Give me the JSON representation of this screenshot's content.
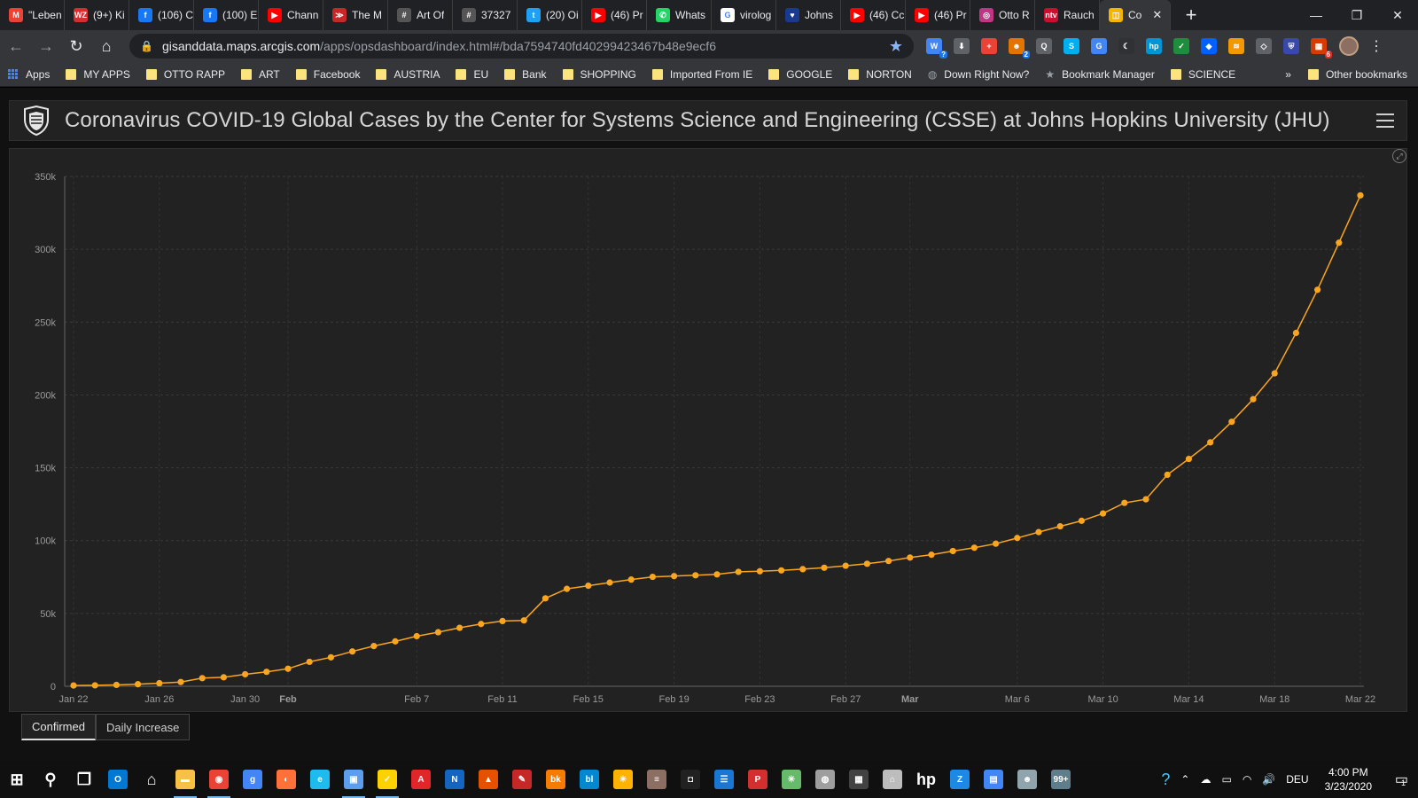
{
  "browser": {
    "tabs": [
      {
        "label": "\"Leben",
        "icon": "gmail-icon",
        "color": "#ea4335",
        "glyph": "M"
      },
      {
        "label": "(9+) Ki",
        "icon": "wz-icon",
        "color": "#d32f2f",
        "glyph": "WZ"
      },
      {
        "label": "(106) C",
        "icon": "facebook-icon",
        "color": "#1877f2",
        "glyph": "f"
      },
      {
        "label": "(100) E",
        "icon": "facebook-icon",
        "color": "#1877f2",
        "glyph": "f"
      },
      {
        "label": "Chann",
        "icon": "youtube-icon",
        "color": "#ff0000",
        "glyph": "▶"
      },
      {
        "label": "The M",
        "icon": "red-swirl-icon",
        "color": "#c62828",
        "glyph": "≫"
      },
      {
        "label": "Art Of",
        "icon": "art-icon",
        "color": "#555555",
        "glyph": "#"
      },
      {
        "label": "37327",
        "icon": "art-icon",
        "color": "#555555",
        "glyph": "#"
      },
      {
        "label": "(20) Oi",
        "icon": "twitter-icon",
        "color": "#1da1f2",
        "glyph": "t"
      },
      {
        "label": "(46) Pr",
        "icon": "youtube-icon",
        "color": "#ff0000",
        "glyph": "▶"
      },
      {
        "label": "Whats",
        "icon": "whatsapp-icon",
        "color": "#25d366",
        "glyph": "✆"
      },
      {
        "label": "virolog",
        "icon": "google-icon",
        "color": "#ffffff",
        "glyph": "G"
      },
      {
        "label": "Johns",
        "icon": "jhu-icon",
        "color": "#1a3a8f",
        "glyph": "♥"
      },
      {
        "label": "(46) Cc",
        "icon": "youtube-icon",
        "color": "#ff0000",
        "glyph": "▶"
      },
      {
        "label": "(46) Pr",
        "icon": "youtube-icon",
        "color": "#ff0000",
        "glyph": "▶"
      },
      {
        "label": "Otto R",
        "icon": "instagram-icon",
        "color": "#c13584",
        "glyph": "◎"
      },
      {
        "label": "Rauch",
        "icon": "ntv-icon",
        "color": "#c8102e",
        "glyph": "ntv"
      },
      {
        "label": "Co",
        "icon": "arcgis-icon",
        "color": "#f5b400",
        "glyph": "◫",
        "active": true
      }
    ],
    "new_tab": "+",
    "window_controls": {
      "minimize": "—",
      "restore": "❐",
      "close": "✕"
    },
    "url_host": "gisanddata.maps.arcgis.com",
    "url_path": "/apps/opsdashboard/index.html#/bda7594740fd40299423467b48e9ecf6",
    "extensions": [
      {
        "name": "translate-ext-icon",
        "color": "#4285f4",
        "glyph": "W",
        "badge": "?"
      },
      {
        "name": "download-ext-icon",
        "color": "#5f6368",
        "glyph": "⬇",
        "badge": ""
      },
      {
        "name": "plus-ext-icon",
        "color": "#ea4335",
        "glyph": "+",
        "badge": ""
      },
      {
        "name": "people-ext-icon",
        "color": "#e37400",
        "glyph": "☻",
        "badge": "2"
      },
      {
        "name": "search-ext-icon",
        "color": "#5f6368",
        "glyph": "Q",
        "badge": ""
      },
      {
        "name": "skype-ext-icon",
        "color": "#00aff0",
        "glyph": "S",
        "badge": ""
      },
      {
        "name": "gtranslate-ext-icon",
        "color": "#4285f4",
        "glyph": "G",
        "badge": ""
      },
      {
        "name": "moon-ext-icon",
        "color": "#303134",
        "glyph": "☾",
        "badge": ""
      },
      {
        "name": "hp-ext-icon",
        "color": "#0096d6",
        "glyph": "hp",
        "badge": ""
      },
      {
        "name": "check-ext-icon",
        "color": "#1e8e3e",
        "glyph": "✓",
        "badge": ""
      },
      {
        "name": "dropbox-ext-icon",
        "color": "#0061ff",
        "glyph": "◆",
        "badge": ""
      },
      {
        "name": "rss-ext-icon",
        "color": "#f29900",
        "glyph": "≋",
        "badge": ""
      },
      {
        "name": "diamond-ext-icon",
        "color": "#5f6368",
        "glyph": "◇",
        "badge": ""
      },
      {
        "name": "shield-ext-icon",
        "color": "#3949ab",
        "glyph": "⛨",
        "badge": ""
      },
      {
        "name": "office-ext-icon",
        "color": "#d83b01",
        "glyph": "▦",
        "badge": "6"
      }
    ]
  },
  "bookmarks": [
    {
      "label": "Apps",
      "kind": "apps"
    },
    {
      "label": "MY APPS",
      "kind": "folder"
    },
    {
      "label": "OTTO RAPP",
      "kind": "folder"
    },
    {
      "label": "ART",
      "kind": "folder"
    },
    {
      "label": "Facebook",
      "kind": "folder"
    },
    {
      "label": "AUSTRIA",
      "kind": "folder"
    },
    {
      "label": "EU",
      "kind": "folder"
    },
    {
      "label": "Bank",
      "kind": "folder"
    },
    {
      "label": "SHOPPING",
      "kind": "folder"
    },
    {
      "label": "Imported From IE",
      "kind": "folder"
    },
    {
      "label": "GOOGLE",
      "kind": "folder"
    },
    {
      "label": "NORTON",
      "kind": "folder"
    },
    {
      "label": "Down Right Now?",
      "kind": "globe"
    },
    {
      "label": "Bookmark Manager",
      "kind": "star"
    },
    {
      "label": "SCIENCE",
      "kind": "folder"
    }
  ],
  "bookmarks_more": "»",
  "bookmarks_other": "Other bookmarks",
  "dashboard": {
    "title": "Coronavirus COVID-19 Global Cases by the Center for Systems Science and Engineering (CSSE) at Johns Hopkins University (JHU)",
    "panel_tabs": [
      {
        "label": "Confirmed",
        "active": true
      },
      {
        "label": "Daily Increase",
        "active": false
      }
    ]
  },
  "chart_data": {
    "type": "line",
    "title": "",
    "xlabel": "",
    "ylabel": "",
    "ylim": [
      0,
      350000
    ],
    "yticks": [
      0,
      50000,
      100000,
      150000,
      200000,
      250000,
      300000,
      350000
    ],
    "ytick_labels": [
      "0",
      "50k",
      "100k",
      "150k",
      "200k",
      "250k",
      "300k",
      "350k"
    ],
    "x_start": "Jan 22",
    "x_end": "Mar 22",
    "xtick_labels": [
      "Jan 22",
      "Jan 26",
      "Jan 30",
      "Feb",
      "Feb 7",
      "Feb 11",
      "Feb 15",
      "Feb 19",
      "Feb 23",
      "Feb 27",
      "Mar",
      "Mar 6",
      "Mar 10",
      "Mar 14",
      "Mar 18",
      "Mar 22"
    ],
    "xtick_bold": [
      "Feb",
      "Mar"
    ],
    "grid": true,
    "color": "#f9a520",
    "series": [
      {
        "values": [
          555,
          654,
          941,
          1434,
          2118,
          2927,
          5578,
          6166,
          8234,
          9927,
          12038,
          16787,
          19881,
          23892,
          27635,
          30817,
          34391,
          37120,
          40150,
          42762,
          44802,
          45221,
          60368,
          66885,
          69030,
          71224,
          73258,
          75136,
          75639,
          76197,
          76819,
          78572,
          78958,
          79561,
          80406,
          81388,
          82746,
          84112,
          86011,
          88369,
          90306,
          92840,
          95120,
          97886,
          101801,
          105847,
          109821,
          113590,
          118620,
          125875,
          128352,
          145205,
          156101,
          167454,
          181574,
          197102,
          214821,
          242570,
          272208,
          304507,
          337020
        ]
      }
    ]
  },
  "taskbar": {
    "apps": [
      {
        "name": "start-icon",
        "color": "#ffffff",
        "glyph": "⊞",
        "run": false
      },
      {
        "name": "search-icon",
        "color": "#ffffff",
        "glyph": "⚲",
        "run": false
      },
      {
        "name": "task-view-icon",
        "color": "#ffffff",
        "glyph": "❐",
        "run": false
      },
      {
        "name": "outlook-icon",
        "color": "#0078d4",
        "glyph": "O",
        "run": false
      },
      {
        "name": "home-icon",
        "color": "#ffffff",
        "glyph": "⌂",
        "run": false
      },
      {
        "name": "file-explorer-icon",
        "color": "#f8c146",
        "glyph": "▬",
        "run": true
      },
      {
        "name": "chrome-icon",
        "color": "#ea4335",
        "glyph": "◉",
        "run": true
      },
      {
        "name": "google-search-icon",
        "color": "#4285f4",
        "glyph": "g",
        "run": false
      },
      {
        "name": "firefox-icon",
        "color": "#ff7139",
        "glyph": "◐",
        "run": false
      },
      {
        "name": "ie-icon",
        "color": "#1ebbee",
        "glyph": "e",
        "run": false
      },
      {
        "name": "photos-icon",
        "color": "#5c9ded",
        "glyph": "▣",
        "run": true
      },
      {
        "name": "norton-icon",
        "color": "#fed200",
        "glyph": "✓",
        "run": true
      },
      {
        "name": "acrobat-icon",
        "color": "#e12528",
        "glyph": "A",
        "run": false
      },
      {
        "name": "app-blue-icon",
        "color": "#1565c0",
        "glyph": "N",
        "run": false
      },
      {
        "name": "app-orange-icon",
        "color": "#e65100",
        "glyph": "▲",
        "run": false
      },
      {
        "name": "app-red-icon",
        "color": "#c62828",
        "glyph": "✎",
        "run": false
      },
      {
        "name": "booksmart-icon",
        "color": "#f57c00",
        "glyph": "bk",
        "run": false
      },
      {
        "name": "blurb-icon",
        "color": "#0288d1",
        "glyph": "bl",
        "run": false
      },
      {
        "name": "weather-icon",
        "color": "#ffb300",
        "glyph": "☀",
        "run": false
      },
      {
        "name": "app-stripe-icon",
        "color": "#8d6e63",
        "glyph": "≡",
        "run": false
      },
      {
        "name": "camera-app-icon",
        "color": "#212121",
        "glyph": "◘",
        "run": false
      },
      {
        "name": "notes-icon",
        "color": "#1976d2",
        "glyph": "☰",
        "run": false
      },
      {
        "name": "pdf-icon",
        "color": "#d32f2f",
        "glyph": "P",
        "run": false
      },
      {
        "name": "network-app-icon",
        "color": "#66bb6a",
        "glyph": "✳",
        "run": false
      },
      {
        "name": "app-globe-icon",
        "color": "#9e9e9e",
        "glyph": "◍",
        "run": false
      },
      {
        "name": "calculator-icon",
        "color": "#424242",
        "glyph": "▦",
        "run": false
      },
      {
        "name": "app-hat-icon",
        "color": "#bdbdbd",
        "glyph": "⌂",
        "run": false
      },
      {
        "name": "hp-app-icon",
        "color": "#ffffff",
        "glyph": "hp",
        "run": false
      },
      {
        "name": "app-z-icon",
        "color": "#1e88e5",
        "glyph": "Z",
        "run": false
      },
      {
        "name": "store-icon",
        "color": "#4285f4",
        "glyph": "▤",
        "run": false
      },
      {
        "name": "app-people-icon",
        "color": "#90a4ae",
        "glyph": "☻",
        "run": false
      },
      {
        "name": "app-badge-icon",
        "color": "#607d8b",
        "glyph": "99+",
        "run": false
      }
    ],
    "tray_expand": "⌃",
    "language": "DEU",
    "time": "4:00 PM",
    "date": "3/23/2020",
    "notifications": "1"
  }
}
